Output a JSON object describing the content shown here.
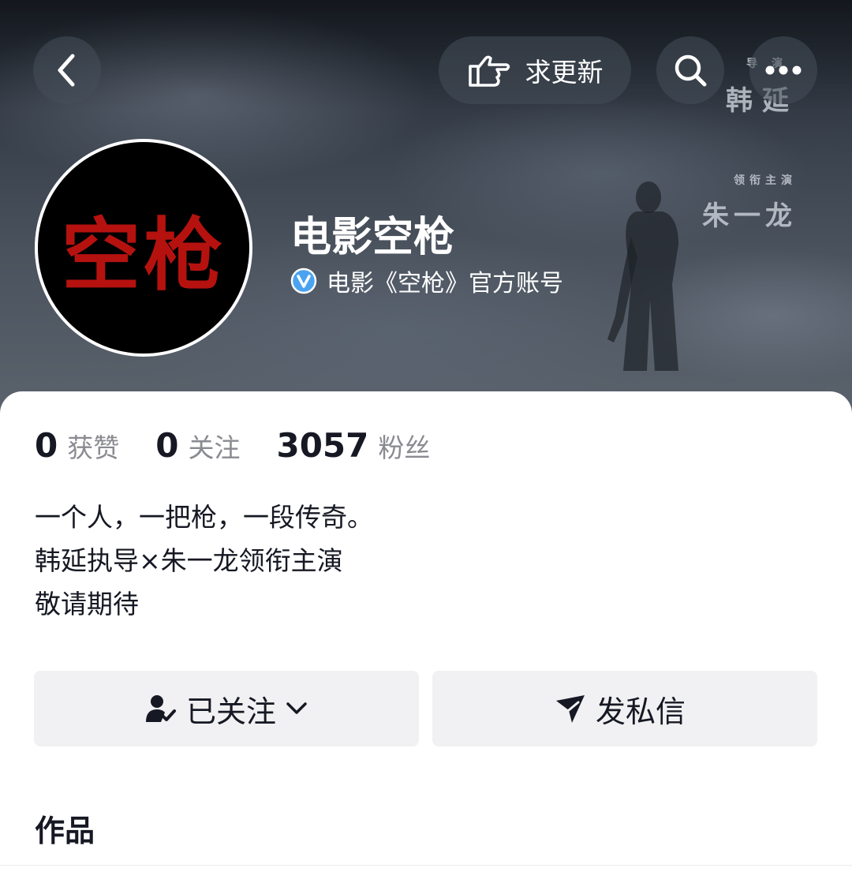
{
  "header": {
    "request_update_label": "求更新",
    "icons": [
      "back-icon",
      "pointing-hand-icon",
      "search-icon",
      "more-icon"
    ]
  },
  "poster": {
    "director_role": "导演",
    "director_name": "韩延",
    "actor_role": "领衔主演",
    "actor_name": "朱一龙"
  },
  "profile": {
    "avatar_text": "空枪",
    "name": "电影空枪",
    "verified_label": "电影《空枪》官方账号",
    "verified_color": "#4aa3f0"
  },
  "stats": [
    {
      "value": "0",
      "label": "获赞"
    },
    {
      "value": "0",
      "label": "关注"
    },
    {
      "value": "3057",
      "label": "粉丝"
    }
  ],
  "bio": [
    "一个人，一把枪，一段传奇。",
    "韩延执导×朱一龙领衔主演",
    "敬请期待"
  ],
  "actions": {
    "follow_label": "已关注",
    "message_label": "发私信"
  },
  "tabs": {
    "works_label": "作品"
  }
}
